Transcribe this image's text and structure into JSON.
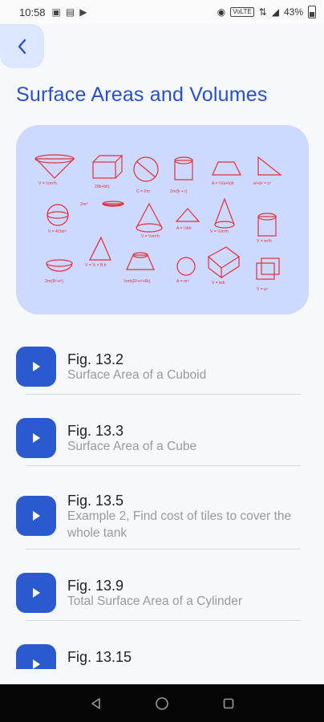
{
  "status_bar": {
    "time": "10:58",
    "network_badge": "VoLTE",
    "battery": "43%",
    "icons": [
      "signal-icon",
      "image-icon",
      "youtube-icon",
      "record-icon",
      "wifi-icon",
      "battery-icon"
    ]
  },
  "header": {
    "title": "Surface Areas and Volumes"
  },
  "items": [
    {
      "fig": "Fig. 13.2",
      "desc": "Surface Area of a Cuboid"
    },
    {
      "fig": "Fig. 13.3",
      "desc": "Surface Area of a Cube"
    },
    {
      "fig": "Fig. 13.5",
      "desc": "Example 2, Find cost of tiles to cover the whole tank"
    },
    {
      "fig": "Fig. 13.9",
      "desc": "Total Surface Area of a Cylinder"
    },
    {
      "fig": "Fig. 13.15",
      "desc": ""
    }
  ],
  "colors": {
    "accent": "#2b59cf",
    "title": "#2651c9",
    "hero_bg": "#cdd9ff",
    "sketch": "#e0303a"
  }
}
